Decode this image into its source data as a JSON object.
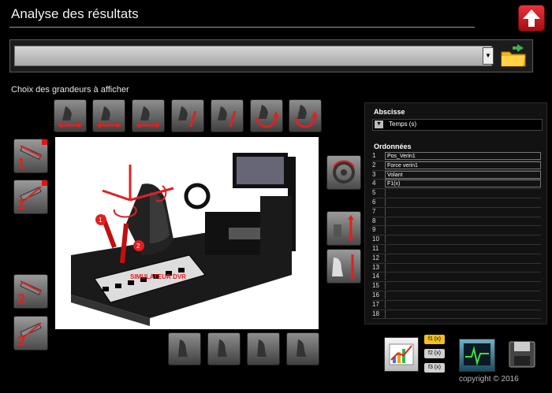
{
  "header": {
    "title": "Analyse des résultats"
  },
  "file_select": {
    "value": ""
  },
  "selector": {
    "label": "Choix des grandeurs à afficher"
  },
  "top_buttons": [
    {
      "name": "x-translation-button"
    },
    {
      "name": "y-translation-button"
    },
    {
      "name": "z-translation-button"
    },
    {
      "name": "alpha-rotation-button"
    },
    {
      "name": "alpha-rotation-alt-button"
    },
    {
      "name": "phi-rotation-button"
    },
    {
      "name": "phi-rotation-alt-button"
    }
  ],
  "left_buttons": [
    {
      "label": "1",
      "marked": true
    },
    {
      "label": "1",
      "marked": true
    },
    {
      "label": "2",
      "marked": false
    },
    {
      "label": "2",
      "marked": false
    }
  ],
  "image": {
    "caption": "SIMULATEUR DVR"
  },
  "right_panel": {
    "abscisse_title": "Abscisse",
    "abscisse_value": "Temps (s)",
    "ordonnees_title": "Ordonnées",
    "rows": [
      {
        "idx": "1",
        "value": "Pos_Verin1"
      },
      {
        "idx": "2",
        "value": "Force verin1"
      },
      {
        "idx": "3",
        "value": "Volant"
      },
      {
        "idx": "4",
        "value": "F1(x)"
      },
      {
        "idx": "5",
        "value": ""
      },
      {
        "idx": "6",
        "value": ""
      },
      {
        "idx": "7",
        "value": ""
      },
      {
        "idx": "8",
        "value": ""
      },
      {
        "idx": "9",
        "value": ""
      },
      {
        "idx": "10",
        "value": ""
      },
      {
        "idx": "11",
        "value": ""
      },
      {
        "idx": "12",
        "value": ""
      },
      {
        "idx": "13",
        "value": ""
      },
      {
        "idx": "14",
        "value": ""
      },
      {
        "idx": "15",
        "value": ""
      },
      {
        "idx": "16",
        "value": ""
      },
      {
        "idx": "17",
        "value": ""
      },
      {
        "idx": "18",
        "value": ""
      }
    ]
  },
  "functions": [
    "f1 (x)",
    "f2 (x)",
    "f3 (x)"
  ],
  "footer": {
    "copyright": "copyright © 2016"
  },
  "colors": {
    "accent_red": "#e02020",
    "function_active": "#f0c020"
  }
}
